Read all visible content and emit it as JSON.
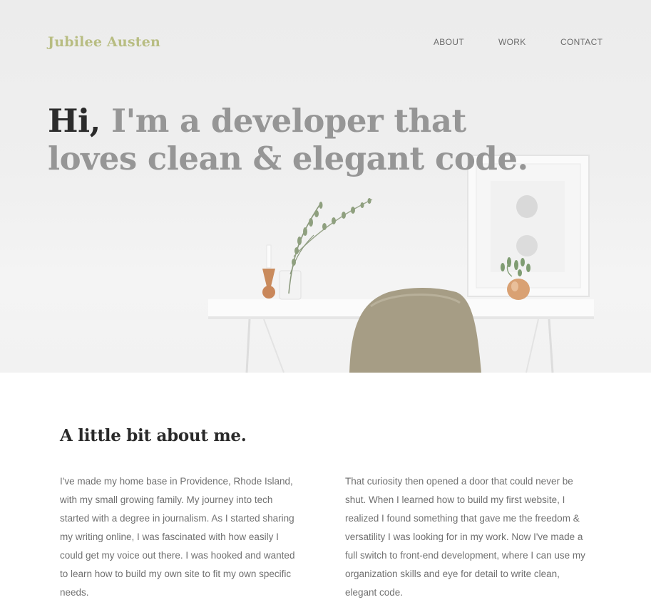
{
  "header": {
    "brand": "Jubilee Austen",
    "nav": [
      {
        "label": "ABOUT"
      },
      {
        "label": "WORK"
      },
      {
        "label": "CONTACT"
      }
    ]
  },
  "hero": {
    "greeting": "Hi,",
    "headline_rest": " I'm a developer that loves clean & elegant code."
  },
  "about": {
    "title": "A little bit about me.",
    "paragraphs": [
      "I've made my home base in Providence, Rhode Island, with my small growing family. My journey into tech started with a degree in journalism. As I started sharing my writing online, I was fascinated with how easily I could get my voice out there. I was hooked and wanted to learn how to build my own site to fit my own specific needs.",
      "That curiosity then opened a door that could never be shut. When I learned how to build my first website, I realized I found something that gave me the freedom & versatility I was looking for in my work. Now I've made a full switch to front-end development, where I can use my organization skills and eye for detail to write clean, elegant code."
    ]
  },
  "colors": {
    "brand": "#b8bd82",
    "headline_dark": "#2b2b2b",
    "headline_light": "#969696",
    "chair": "#a69d85",
    "pot": "#d09a6c"
  }
}
